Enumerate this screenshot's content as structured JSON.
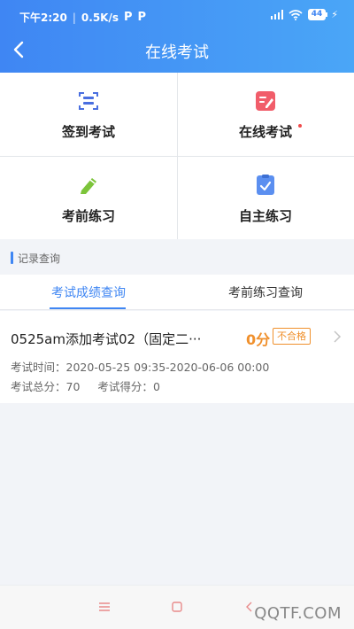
{
  "status_bar": {
    "time": "下午2:20",
    "speed": "0.5K/s",
    "app_icons": [
      "P",
      "P"
    ],
    "battery": "44"
  },
  "header": {
    "title": "在线考试"
  },
  "menu": {
    "items": [
      {
        "label": "签到考试",
        "icon": "scan-icon"
      },
      {
        "label": "在线考试",
        "icon": "exam-edit-icon",
        "has_dot": true
      },
      {
        "label": "考前练习",
        "icon": "pencil-icon"
      },
      {
        "label": "自主练习",
        "icon": "checklist-icon"
      }
    ]
  },
  "section": {
    "title": "记录查询"
  },
  "tabs": [
    {
      "label": "考试成绩查询",
      "active": true
    },
    {
      "label": "考前练习查询",
      "active": false
    }
  ],
  "record": {
    "name": "0525am添加考试02（固定二···",
    "score": "0分",
    "result": "不合格",
    "time_label": "考试时间：",
    "time_value": "2020-05-25 09:35-2020-06-06 00:00",
    "total_label": "考试总分：",
    "total_value": "70",
    "got_label": "考试得分：",
    "got_value": "0"
  },
  "watermark": "QQTF.COM",
  "colors": {
    "accent": "#3f86f3",
    "warning": "#f0902c",
    "alert_dot": "#f04b4b"
  }
}
